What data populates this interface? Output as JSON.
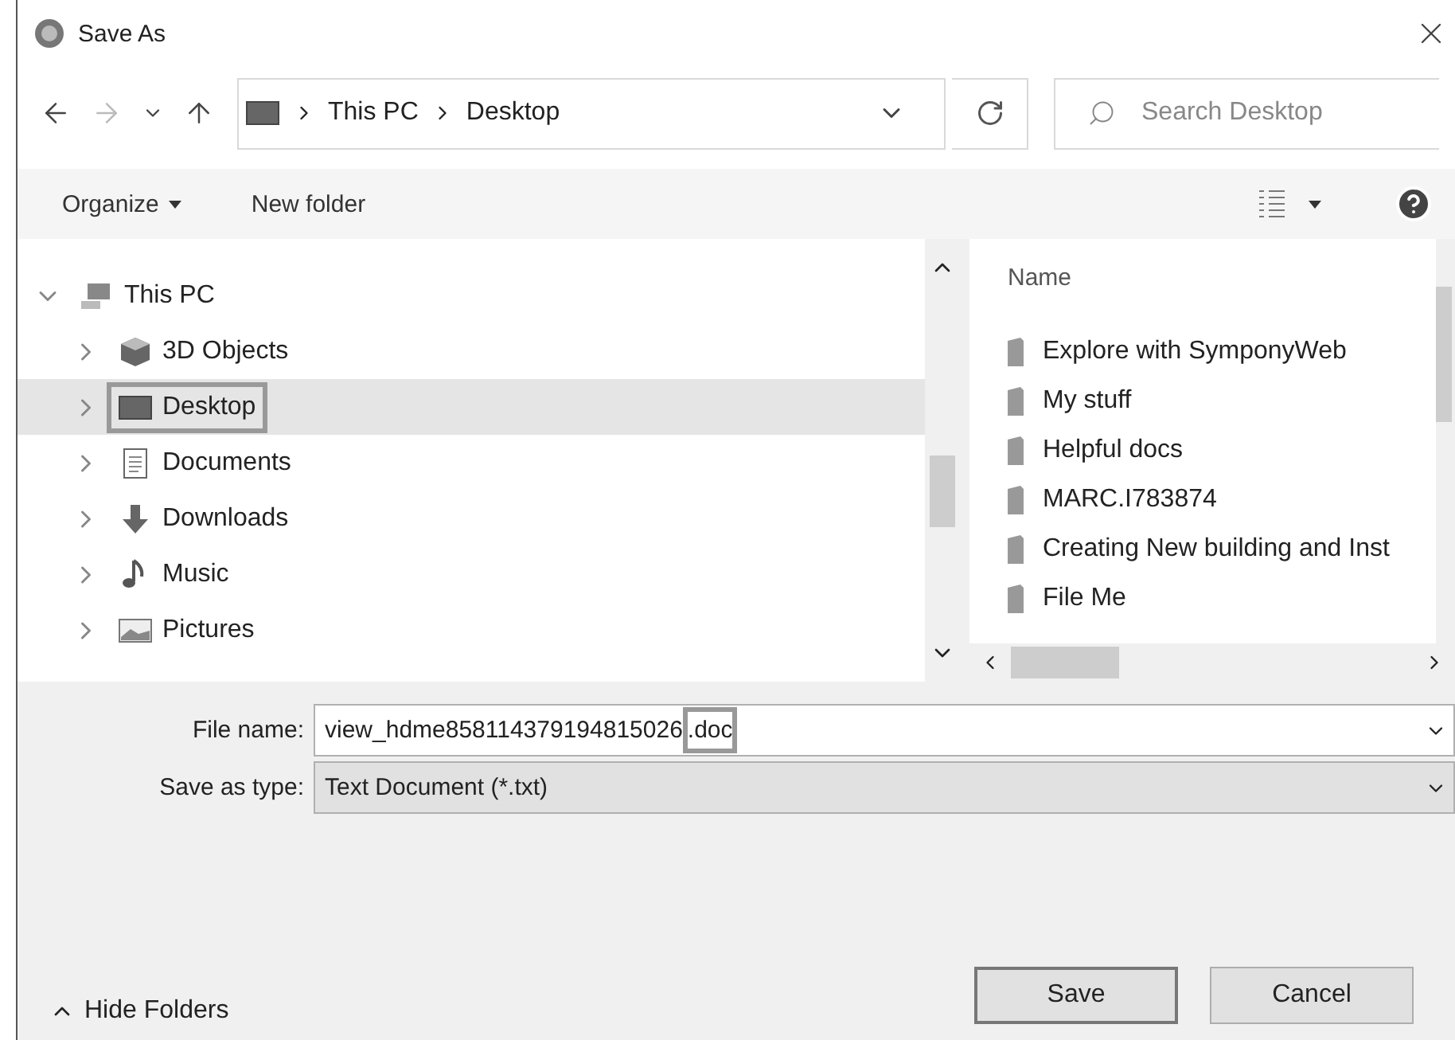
{
  "window": {
    "title": "Save As"
  },
  "address_bar": {
    "path": [
      "This PC",
      "Desktop"
    ]
  },
  "search": {
    "placeholder": "Search Desktop"
  },
  "toolbar": {
    "organize": "Organize",
    "new_folder": "New folder"
  },
  "nav_tree": [
    {
      "label": "This PC",
      "kind": "computer",
      "expanded": true,
      "selected": false,
      "highlighted": false,
      "children": [
        {
          "label": "3D Objects",
          "kind": "cube",
          "expanded": false,
          "selected": false,
          "highlighted": false
        },
        {
          "label": "Desktop",
          "kind": "desktop",
          "expanded": false,
          "selected": true,
          "highlighted": true
        },
        {
          "label": "Documents",
          "kind": "documents",
          "expanded": false,
          "selected": false,
          "highlighted": false
        },
        {
          "label": "Downloads",
          "kind": "downloads",
          "expanded": false,
          "selected": false,
          "highlighted": false
        },
        {
          "label": "Music",
          "kind": "music",
          "expanded": false,
          "selected": false,
          "highlighted": false
        },
        {
          "label": "Pictures",
          "kind": "pictures",
          "expanded": false,
          "selected": false,
          "highlighted": false
        }
      ]
    }
  ],
  "file_list": {
    "column": "Name",
    "items": [
      "Explore with SymponyWeb",
      "My stuff",
      "Helpful docs",
      "MARC.I783874",
      "Creating New building and Inst",
      "File Me"
    ]
  },
  "file_name": {
    "label": "File name:",
    "value": "view_hdme858114379194815026",
    "highlighted_part": ".doc"
  },
  "save_as_type": {
    "label": "Save as type:",
    "value": "Text Document (*.txt)"
  },
  "hide_folders": "Hide Folders",
  "buttons": [
    "Save",
    "Cancel"
  ]
}
